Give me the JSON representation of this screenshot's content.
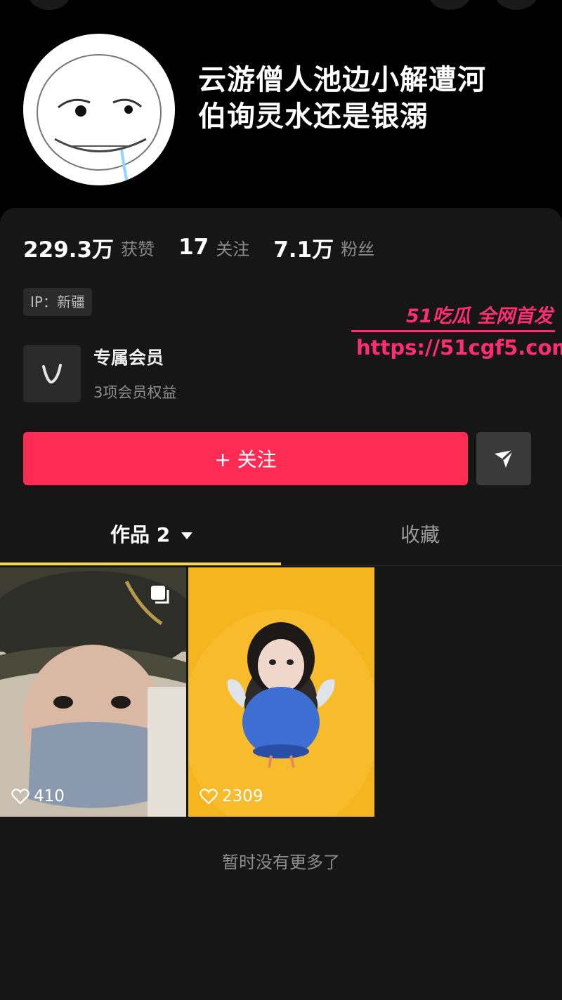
{
  "profile": {
    "nickname_line1": "云游僧人池边小解遭河",
    "nickname_line2": "伯询灵水还是银溺"
  },
  "stats": {
    "likes_num": "229.3万",
    "likes_label": "获赞",
    "following_num": "17",
    "following_label": "关注",
    "followers_num": "7.1万",
    "followers_label": "粉丝"
  },
  "ip": "IP：新疆",
  "membership": {
    "title": "专属会员",
    "subtitle": "3项会员权益",
    "icon": "v-icon"
  },
  "watermark": {
    "brand": "51吃瓜 全网首发",
    "url": "https://51cgf5.com"
  },
  "actions": {
    "follow_label": "+ 关注",
    "share_icon": "send-icon"
  },
  "tabs": {
    "works_label": "作品 2",
    "favorites_label": "收藏"
  },
  "videos": [
    {
      "likes": "410",
      "multi_image": true
    },
    {
      "likes": "2309",
      "multi_image": false
    }
  ],
  "footer": {
    "no_more": "暂时没有更多了"
  },
  "colors": {
    "follow_button": "#fe2c55",
    "tab_indicator": "#f7d94a",
    "watermark": "#ff2d72"
  }
}
